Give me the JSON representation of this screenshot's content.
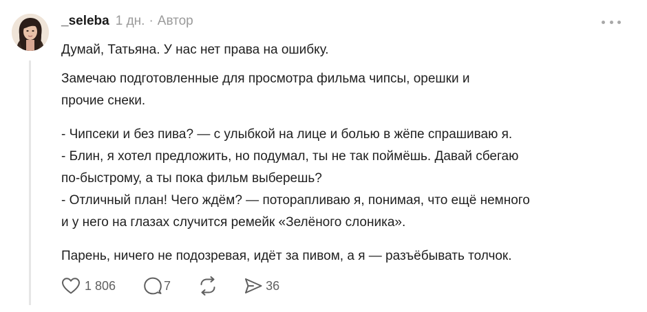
{
  "comment": {
    "username": "_seleba",
    "time": "1 дн.",
    "separator": "·",
    "role": "Автор",
    "paragraphs": [
      "Думай, Татьяна. У нас нет права на ошибку.",
      "Замечаю подготовленные для просмотра фильма чипсы, орешки и",
      "прочие снеки.",
      "- Чипсеки и без пива? — с улыбкой на лице и болью в жёпе спрашиваю я.",
      "- Блин, я хотел предложить, но подумал, ты не так поймёшь. Давай сбегаю",
      "по-быстрому, а ты пока фильм выберешь?",
      "- Отличный план! Чего ждём? — поторапливаю я, понимая, что ещё немного",
      "и у него на глазах случится ремейк «Зелёного слоника».",
      "Парень, ничего не подозревая, идёт за пивом, а я — разъёбывать толчок."
    ],
    "actions": {
      "likes": "1 806",
      "replies": "7",
      "shares": "36"
    },
    "icons": {
      "more": "more-dots-icon",
      "like": "heart-icon",
      "reply": "speech-bubble-icon",
      "repost": "repost-arrows-icon",
      "share": "send-arrow-icon"
    }
  }
}
